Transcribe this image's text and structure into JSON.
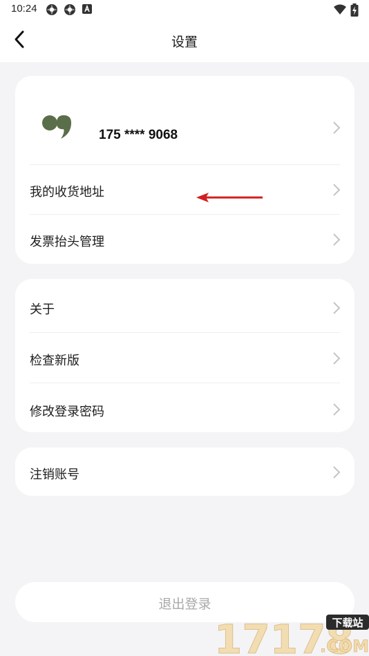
{
  "status_bar": {
    "time": "10:24",
    "icons": [
      "app-notification-icon",
      "app-notification-icon",
      "a-notification-icon",
      "wifi-icon",
      "battery-charging-icon"
    ]
  },
  "header": {
    "title": "设置",
    "back_icon": "chevron-left-icon"
  },
  "profile": {
    "phone": "175 **** 9068",
    "avatar_icon": "quote-bubble-avatar",
    "avatar_color": "#5b6e4a"
  },
  "groups": [
    {
      "items": [
        {
          "label": "我的收货地址"
        },
        {
          "label": "发票抬头管理"
        }
      ]
    },
    {
      "items": [
        {
          "label": "关于"
        },
        {
          "label": "检查新版"
        },
        {
          "label": "修改登录密码"
        }
      ]
    },
    {
      "items": [
        {
          "label": "注销账号"
        }
      ]
    }
  ],
  "logout": {
    "label": "退出登录"
  },
  "annotation": {
    "color": "#d21f1f"
  },
  "watermark": {
    "text": "17178",
    "sub": "下载站",
    "domain": ".COM"
  }
}
